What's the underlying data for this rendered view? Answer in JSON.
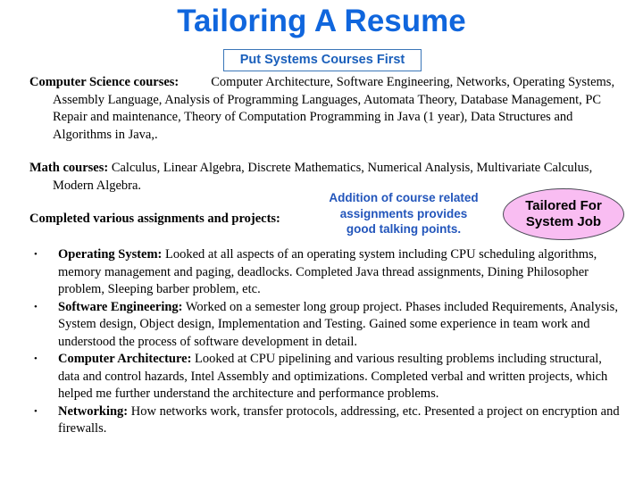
{
  "slide": {
    "title": "Tailoring A Resume",
    "callout_box": "Put Systems Courses First",
    "sections": {
      "cs_courses": {
        "label": "Computer Science courses:",
        "body": "Computer Architecture, Software Engineering, Networks, Operating Systems, Assembly Language, Analysis of Programming Languages, Automata Theory, Database Management, PC Repair and maintenance, Theory of Computation Programming in Java (1 year), Data Structures and Algorithms in Java,."
      },
      "math_courses": {
        "label": "Math courses:",
        "body": "Calculus, Linear Algebra, Discrete Mathematics, Numerical Analysis, Multivariate Calculus, Modern Algebra."
      },
      "completed_line": "Completed various assignments and projects:"
    },
    "annotation": {
      "line1": "Addition of course related",
      "line2": "assignments provides",
      "line3": "good talking points."
    },
    "oval": {
      "line1": "Tailored For",
      "line2": "System Job"
    },
    "bullets": [
      {
        "marker": "•",
        "label": "Operating System:",
        "text": "  Looked at all aspects of an operating system including CPU scheduling algorithms, memory management and paging, deadlocks.  Completed Java thread assignments, Dining Philosopher problem, Sleeping barber problem, etc."
      },
      {
        "marker": "•",
        "label": "Software Engineering:",
        "text": " Worked on a semester long group project.  Phases included Requirements, Analysis, System design, Object design, Implementation and Testing.  Gained some experience in team work and understood the process of software development in detail."
      },
      {
        "marker": "•",
        "label": "Computer Architecture:",
        "text": " Looked at CPU pipelining and various resulting problems including structural, data and control hazards, Intel Assembly and optimizations.  Completed verbal and written projects, which helped me further understand the architecture and performance problems."
      },
      {
        "marker": "•",
        "label": "Networking:",
        "text": " How networks work, transfer protocols, addressing, etc.  Presented a project on encryption and firewalls."
      }
    ],
    "colors": {
      "title_blue": "#1066dd",
      "box_text_blue": "#1a5fbb",
      "box_border_blue": "#3a76b8",
      "annotation_blue": "#2255bb",
      "oval_fill_pink": "#f9bdf2",
      "oval_border": "#4a4a55",
      "body_text": "#000000",
      "background": "#ffffff"
    }
  }
}
